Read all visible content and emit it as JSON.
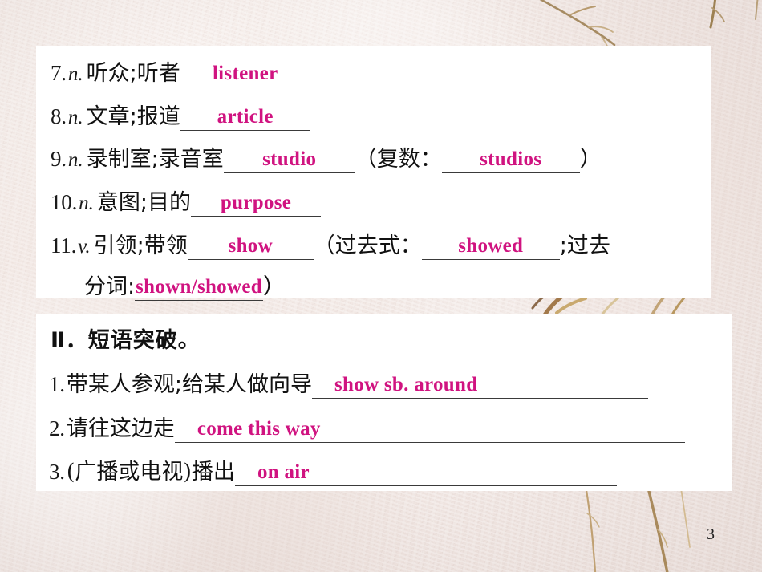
{
  "slide": {
    "page_number": "3",
    "accent_color": "#d01380",
    "panel_color": "#ffffff",
    "background_color": "#f2e8e4"
  },
  "section_one": {
    "items": [
      {
        "number": "7.",
        "pos": "n.",
        "chinese": "听众;听者",
        "answer": "listener"
      },
      {
        "number": "8.",
        "pos": "n.",
        "chinese": "文章;报道",
        "answer": "article"
      },
      {
        "number": "9.",
        "pos": "n.",
        "chinese": "录制室;录音室",
        "answer": "studio",
        "paren_open": "（",
        "extra_label": "复数：",
        "extra_answer": "studios",
        "paren_close": "）"
      },
      {
        "number": "10.",
        "pos": "n.",
        "chinese": "意图;目的",
        "answer": "purpose"
      },
      {
        "number": "11.",
        "pos": "v.",
        "chinese": "引领;带领",
        "answer": "show",
        "paren_open": "（",
        "extra_label": "过去式：",
        "extra_answer": "showed",
        "tail": ";过去",
        "cont_label": "分词:",
        "cont_answer": "shown/showed",
        "paren_close": "）"
      }
    ]
  },
  "section_two": {
    "heading": "Ⅱ．短语突破。",
    "items": [
      {
        "number": "1.",
        "chinese": "带某人参观;给某人做向导",
        "answer": "show sb. around"
      },
      {
        "number": "2.",
        "chinese": "请往这边走",
        "answer": "come this way"
      },
      {
        "number": "3.",
        "chinese": "(广播或电视)播出",
        "answer": "on air"
      }
    ]
  }
}
